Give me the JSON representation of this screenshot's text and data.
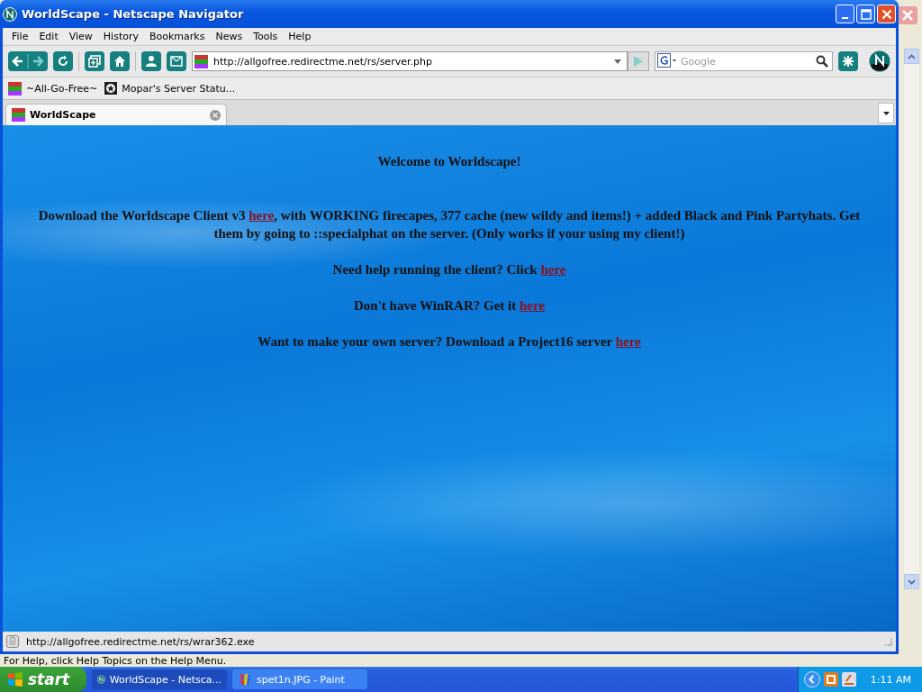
{
  "window": {
    "title": "WorldScape - Netscape Navigator"
  },
  "menu": [
    "File",
    "Edit",
    "View",
    "History",
    "Bookmarks",
    "News",
    "Tools",
    "Help"
  ],
  "address": {
    "value": "http://allgofree.redirectme.net/rs/server.php"
  },
  "search": {
    "placeholder": "Google"
  },
  "bookmarks": [
    {
      "label": "~All-Go-Free~",
      "kind": "site"
    },
    {
      "label": "Mopar's Server Statu...",
      "kind": "star"
    }
  ],
  "tabs": [
    {
      "label": "WorldScape",
      "selected": true
    }
  ],
  "page": {
    "paragraphs": [
      [
        {
          "kind": "text",
          "text": "Welcome to Worldscape!"
        }
      ],
      [
        {
          "kind": "text",
          "text": "Download the Worldscape Client v3 "
        },
        {
          "kind": "link",
          "text": "here"
        },
        {
          "kind": "text",
          "text": ", with WORKING firecapes, 377 cache (new wildy and items!) + added Black and Pink Partyhats. Get them by going to ::specialphat on the server. (Only works if your using my client!)"
        }
      ],
      [
        {
          "kind": "text",
          "text": "Need help running the client? Click "
        },
        {
          "kind": "link",
          "text": "here"
        }
      ],
      [
        {
          "kind": "text",
          "text": "Don't have WinRAR? Get it "
        },
        {
          "kind": "link",
          "text": "here"
        }
      ],
      [
        {
          "kind": "text",
          "text": "Want to make your own server? Download a Project16 server "
        },
        {
          "kind": "link",
          "text": "here"
        }
      ]
    ]
  },
  "status_bar": {
    "text": "http://allgofree.redirectme.net/rs/wrar362.exe"
  },
  "background_window": {
    "status": "For Help, click Help Topics on the Help Menu."
  },
  "taskbar": {
    "start": "start",
    "items": [
      {
        "label": "WorldScape - Netsca...",
        "kind": "netscape",
        "selected": true
      },
      {
        "label": "spet1n.JPG - Paint",
        "kind": "paint",
        "selected": false
      }
    ],
    "clock": "1:11 AM"
  }
}
